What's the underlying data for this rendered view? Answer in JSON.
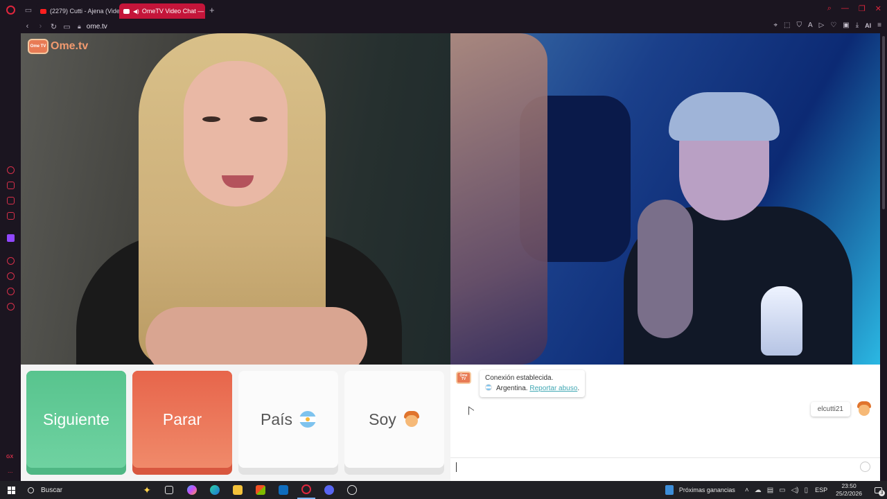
{
  "browser": {
    "tabs": [
      {
        "label": "(2279) Cutti - Ajena (Video",
        "active": false
      },
      {
        "label": "OmeTV Video Chat — ",
        "active": true
      }
    ],
    "url": "ome.tv",
    "ai_label": "AI",
    "accent": "#e0263d"
  },
  "app": {
    "logo_text": "Ome.tv",
    "logo_badge": "Ome TV",
    "buttons": {
      "next": "Siguiente",
      "stop": "Parar",
      "country": "País",
      "gender": "Soy"
    },
    "colors": {
      "next": "#58c48e",
      "stop": "#e7654b"
    }
  },
  "chat": {
    "system_title": "Conexión establecida.",
    "country": "Argentina.",
    "report_link": "Reportar abuso",
    "report_suffix": ".",
    "username": "elcutti21",
    "input_value": ""
  },
  "taskbar": {
    "search_placeholder": "Buscar",
    "weather_label": "Próximas ganancias",
    "language": "ESP",
    "time": "23:50",
    "date": "25/2/2026",
    "notification_count": "3"
  },
  "sidebar": {
    "gx_label": "GX",
    "more_label": "..."
  }
}
